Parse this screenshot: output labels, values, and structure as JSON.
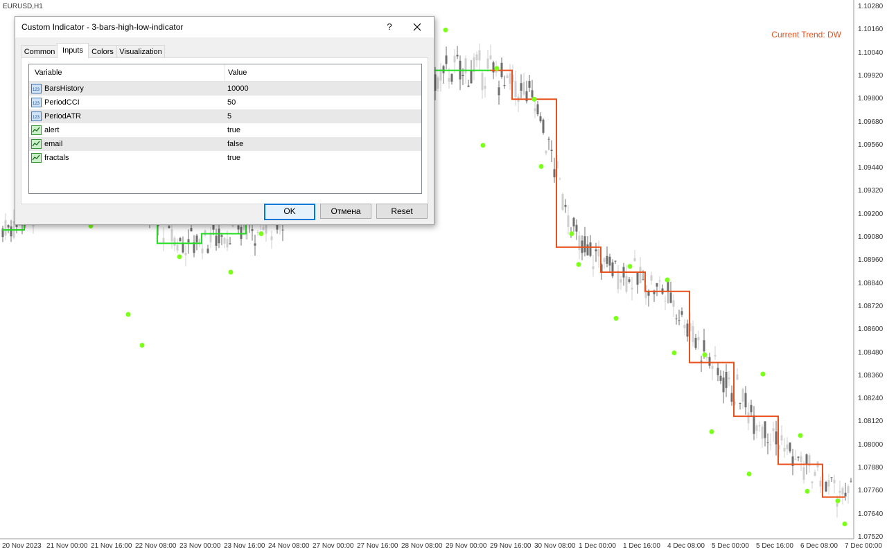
{
  "chart": {
    "symbol": "EURUSD,H1",
    "trend_label": "Current Trend: DW",
    "price_ticks": [
      "1.10280",
      "1.10160",
      "1.10040",
      "1.09920",
      "1.09800",
      "1.09680",
      "1.09560",
      "1.09440",
      "1.09320",
      "1.09200",
      "1.09080",
      "1.08960",
      "1.08840",
      "1.08720",
      "1.08600",
      "1.08480",
      "1.08360",
      "1.08240",
      "1.08120",
      "1.08000",
      "1.07880",
      "1.07760",
      "1.07640",
      "1.07520"
    ],
    "time_ticks": [
      "20 Nov 2023",
      "21 Nov 00:00",
      "21 Nov 16:00",
      "22 Nov 08:00",
      "23 Nov 00:00",
      "23 Nov 16:00",
      "24 Nov 08:00",
      "27 Nov 00:00",
      "27 Nov 16:00",
      "28 Nov 08:00",
      "29 Nov 00:00",
      "29 Nov 16:00",
      "30 Nov 08:00",
      "1 Dec 00:00",
      "1 Dec 16:00",
      "4 Dec 08:00",
      "5 Dec 00:00",
      "5 Dec 16:00",
      "6 Dec 08:00",
      "7 Dec 00:00"
    ],
    "colors": {
      "up_line": "#22dd22",
      "down_line": "#e8501c",
      "neutral_line": "#f0e020",
      "fractal": "#7cff1a",
      "candle_bull": "#cfcfcf",
      "candle_bear": "#6e6e6e"
    }
  },
  "chart_data": {
    "type": "line",
    "title": "",
    "xlabel": "",
    "ylabel": "",
    "ylim": [
      1.0752,
      1.1028
    ],
    "x": [
      "20 Nov 2023",
      "21 Nov 00:00",
      "21 Nov 16:00",
      "22 Nov 08:00",
      "23 Nov 00:00",
      "23 Nov 16:00",
      "24 Nov 08:00",
      "27 Nov 00:00",
      "27 Nov 16:00",
      "28 Nov 08:00",
      "29 Nov 00:00",
      "29 Nov 16:00",
      "30 Nov 08:00",
      "1 Dec 00:00",
      "1 Dec 16:00",
      "4 Dec 08:00",
      "5 Dec 00:00",
      "5 Dec 16:00",
      "6 Dec 08:00",
      "7 Dec 00:00"
    ],
    "series": [
      {
        "values": [
          1.0912,
          1.0928,
          1.095,
          1.093,
          1.0905,
          1.091,
          1.0915,
          1.093,
          1.096,
          1.096,
          1.0995,
          1.0995,
          1.098,
          1.0903,
          1.089,
          1.088,
          1.0843,
          1.0815,
          1.079,
          1.0773
        ]
      }
    ],
    "fractals": [
      {
        "x": "20 Nov 2023",
        "y": 1.0939
      },
      {
        "x": "21 Nov 16:00",
        "y": 1.0914
      },
      {
        "x": "22 Nov 08:00",
        "y": 1.0852
      },
      {
        "x": "22 Nov 08:00",
        "y": 1.0868
      },
      {
        "x": "23 Nov 00:00",
        "y": 1.0898
      },
      {
        "x": "23 Nov 16:00",
        "y": 1.089
      },
      {
        "x": "24 Nov 08:00",
        "y": 1.091
      },
      {
        "x": "29 Nov 00:00",
        "y": 1.1016
      },
      {
        "x": "29 Nov 16:00",
        "y": 1.0996
      },
      {
        "x": "29 Nov 16:00",
        "y": 1.0956
      },
      {
        "x": "30 Nov 08:00",
        "y": 1.098
      },
      {
        "x": "30 Nov 08:00",
        "y": 1.0945
      },
      {
        "x": "1 Dec 00:00",
        "y": 1.091
      },
      {
        "x": "1 Dec 00:00",
        "y": 1.0894
      },
      {
        "x": "1 Dec 16:00",
        "y": 1.0893
      },
      {
        "x": "1 Dec 16:00",
        "y": 1.0866
      },
      {
        "x": "4 Dec 08:00",
        "y": 1.0886
      },
      {
        "x": "4 Dec 08:00",
        "y": 1.0848
      },
      {
        "x": "5 Dec 00:00",
        "y": 1.0847
      },
      {
        "x": "5 Dec 00:00",
        "y": 1.0807
      },
      {
        "x": "5 Dec 16:00",
        "y": 1.0837
      },
      {
        "x": "5 Dec 16:00",
        "y": 1.0785
      },
      {
        "x": "6 Dec 08:00",
        "y": 1.0805
      },
      {
        "x": "6 Dec 08:00",
        "y": 1.0776
      },
      {
        "x": "7 Dec 00:00",
        "y": 1.0771
      },
      {
        "x": "7 Dec 00:00",
        "y": 1.0759
      }
    ],
    "grid": false,
    "legend": "none"
  },
  "dialog": {
    "title": "Custom Indicator - 3-bars-high-low-indicator",
    "help_label": "?",
    "tabs": [
      {
        "label": "Common",
        "active": false
      },
      {
        "label": "Inputs",
        "active": true
      },
      {
        "label": "Colors",
        "active": false
      },
      {
        "label": "Visualization",
        "active": false
      }
    ],
    "grid": {
      "header_variable": "Variable",
      "header_value": "Value",
      "rows": [
        {
          "name": "BarsHistory",
          "value": "10000",
          "icon": "integer-icon"
        },
        {
          "name": "PeriodCCI",
          "value": "50",
          "icon": "integer-icon"
        },
        {
          "name": "PeriodATR",
          "value": "5",
          "icon": "integer-icon"
        },
        {
          "name": "alert",
          "value": "true",
          "icon": "boolean-icon"
        },
        {
          "name": "email",
          "value": "false",
          "icon": "boolean-icon"
        },
        {
          "name": "fractals",
          "value": "true",
          "icon": "boolean-icon"
        }
      ]
    },
    "buttons": {
      "ok": "OK",
      "cancel": "Отмена",
      "reset": "Reset"
    }
  }
}
